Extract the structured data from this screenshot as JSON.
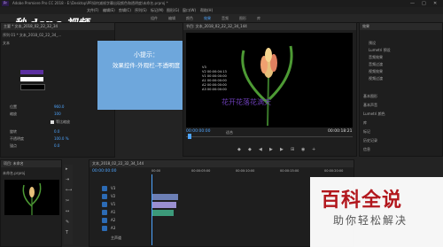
{
  "window": {
    "title": "Adobe Premiere Pro CC 2018 - E:\\Desktop\\PR如何减帧字幕出现颜色和透明度\\未命名.prproj *",
    "controls": [
      "—",
      "□",
      "✕"
    ]
  },
  "logo": {
    "text": "秒 dong 视频"
  },
  "menu": [
    "文件(F)",
    "编辑(E)",
    "剪辑(C)",
    "序列(S)",
    "标记(M)",
    "图形(G)",
    "窗口(W)",
    "帮助(H)"
  ],
  "workspaces": [
    {
      "label": "组件",
      "active": false
    },
    {
      "label": "编辑",
      "active": false
    },
    {
      "label": "颜色",
      "active": false
    },
    {
      "label": "效果",
      "active": true
    },
    {
      "label": "音频",
      "active": false
    },
    {
      "label": "图形",
      "active": false
    },
    {
      "label": "库",
      "active": false
    }
  ],
  "effect_controls": {
    "tab": "主要 * 文本_2018_02_22_32_34",
    "source_label": "序列 01 * 文本_2018_02_22_34_...",
    "section_label": "文本",
    "properties": [
      {
        "label": "位置",
        "value": "960.0"
      },
      {
        "label": "缩放",
        "value": "100"
      },
      {
        "label": "旋转",
        "value": "0.0"
      },
      {
        "label": "不透明度",
        "value": "100.0 %"
      },
      {
        "label": "锚点",
        "value": "0.0"
      }
    ],
    "checkbox_label": "等比缩放",
    "color_swatches": [
      "#5b2fa0",
      "#ffffff",
      "#000000"
    ]
  },
  "tooltip": {
    "line1": "小提示：",
    "line2": "效果控件-外观栏-不透明度"
  },
  "program_monitor": {
    "tab": "节目: 文本_2018_02_22_32_34_144",
    "info_lines": [
      "V3",
      "V2 00:00:04:13",
      "V1 00:00:00:00",
      "A1 00:00:00:00",
      "A2 00:00:00:00",
      "A3 00:00:00:00"
    ],
    "caption": "花开花落花满天",
    "timecode_left": "00:00:00:00",
    "fit_label": "适合",
    "timecode_right": "00:00:18:21"
  },
  "right_panel": {
    "title": "效果",
    "items": [
      "预设",
      "Lumetri 预设",
      "音频效果",
      "音频过渡",
      "视频效果",
      "视频过渡"
    ],
    "sections": [
      "基本图形",
      "基本声音",
      "Lumetri 颜色",
      "库",
      "标记",
      "历史记录",
      "信息"
    ]
  },
  "project_panel": {
    "tab": "项目: 未命名",
    "file": "未命名.prproj"
  },
  "timeline": {
    "tab": "文本_2018_02_22_32_34_144",
    "timecode": "00:00:00:00",
    "ruler": [
      "00:00",
      "00:00:05:00",
      "00:00:10:00",
      "00:00:15:00",
      "00:00:20:00"
    ],
    "tracks": [
      "V3",
      "V2",
      "V1",
      "A1",
      "A2",
      "A3",
      "主声道"
    ]
  },
  "watermark": {
    "main": "百科全说",
    "sub": "助你轻松解决"
  },
  "colors": {
    "accent": "#4ea5ff",
    "tooltip_bg": "#6ea7dc",
    "watermark_red": "#b2171d"
  }
}
